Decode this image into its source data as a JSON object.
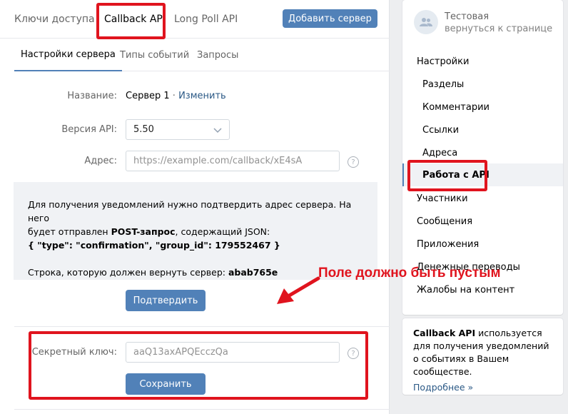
{
  "top_tabs": [
    {
      "label": "Ключи доступа"
    },
    {
      "label": "Callback API"
    },
    {
      "label": "Long Poll API"
    }
  ],
  "add_server_label": "Добавить сервер",
  "sub_tabs": [
    {
      "label": "Настройки сервера"
    },
    {
      "label": "Типы событий"
    },
    {
      "label": "Запросы"
    }
  ],
  "form": {
    "name_label": "Название:",
    "name_value": "Сервер 1",
    "name_separator": "·",
    "rename_link": "Изменить",
    "api_version_label": "Версия API:",
    "api_version_value": "5.50",
    "address_label": "Адрес:",
    "address_placeholder": "https://example.com/callback/xE4sA",
    "help_glyph": "?"
  },
  "info": {
    "line1": "Для получения уведомлений нужно подтвердить адрес сервера. На него",
    "line2_prefix": "будет отправлен ",
    "line2_bold": "POST-запрос",
    "line2_suffix": ", содержащий JSON:",
    "json_line": "{ \"type\": \"confirmation\", \"group_id\": 179552467 }",
    "return_prefix": "Строка, которую должен вернуть сервер: ",
    "return_value": "abab765e"
  },
  "confirm_label": "Подтвердить",
  "secret": {
    "label": "Секретный ключ:",
    "value": "aaQ13axAPQEcczQa",
    "save_label": "Сохранить"
  },
  "annotation_text": "Поле должно быть пустым",
  "sidebar": {
    "group_name": "Тестовая",
    "back_link": "вернуться к странице",
    "items": [
      {
        "label": "Настройки"
      },
      {
        "label": "Разделы"
      },
      {
        "label": "Комментарии"
      },
      {
        "label": "Ссылки"
      },
      {
        "label": "Адреса"
      },
      {
        "label": "Работа с API"
      },
      {
        "label": "Участники"
      },
      {
        "label": "Сообщения"
      },
      {
        "label": "Приложения"
      },
      {
        "label": "Денежные переводы"
      },
      {
        "label": "Жалобы на контент"
      }
    ]
  },
  "help_card": {
    "title_bold": "Callback API",
    "text": " используется для получения уведомлений о событиях в Вашем сообществе.",
    "more_link": "Подробнее »"
  },
  "colors": {
    "accent": "#5181b8",
    "highlight_red": "#e0141e",
    "link": "#2a5885"
  }
}
